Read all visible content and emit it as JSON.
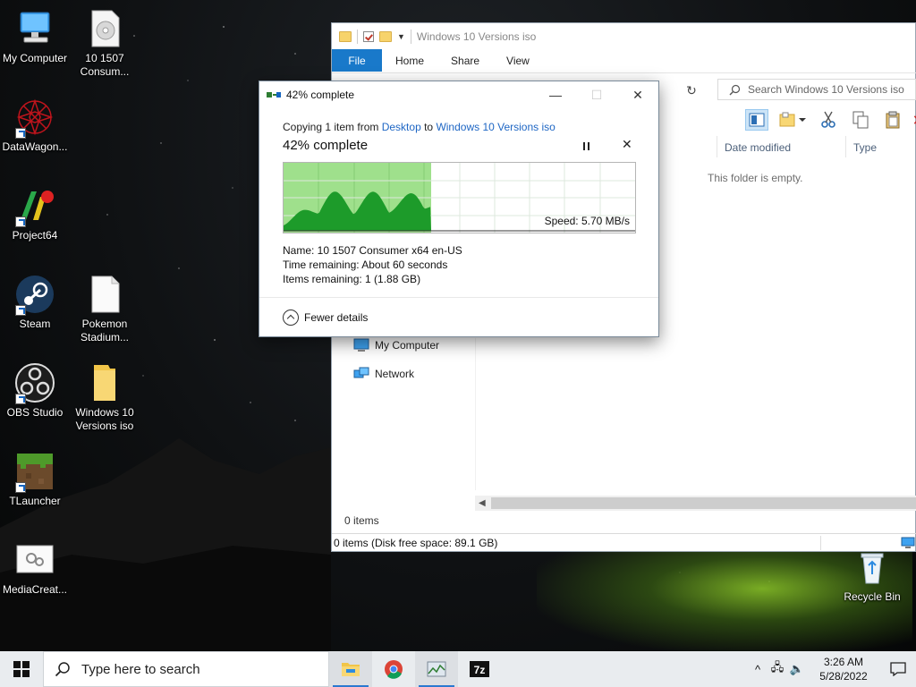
{
  "desktop": {
    "icons": [
      {
        "label": "My Computer",
        "icon": "computer-icon"
      },
      {
        "label": "10 1507 Consum...",
        "icon": "disc-image-icon"
      },
      {
        "label": "DataWagon...",
        "icon": "datawagon-icon"
      },
      {
        "label": "Project64",
        "icon": "project64-icon"
      },
      {
        "label": "Steam",
        "icon": "steam-icon"
      },
      {
        "label": "Pokemon Stadium...",
        "icon": "file-icon"
      },
      {
        "label": "OBS Studio",
        "icon": "obs-icon"
      },
      {
        "label": "Windows 10 Versions iso",
        "icon": "folder-icon"
      },
      {
        "label": "TLauncher",
        "icon": "tlauncher-icon"
      },
      {
        "label": "MediaCreat...",
        "icon": "media-creation-tool-icon"
      },
      {
        "label": "Recycle Bin",
        "icon": "recycle-bin-icon"
      }
    ]
  },
  "explorer": {
    "title": "Windows 10 Versions iso",
    "tabs": {
      "file": "File",
      "home": "Home",
      "share": "Share",
      "view": "View"
    },
    "search_placeholder": "Search Windows 10 Versions iso",
    "columns": {
      "date_modified": "Date modified",
      "type": "Type"
    },
    "empty_message": "This folder is empty.",
    "nav": {
      "my_computer": "My Computer",
      "network": "Network"
    },
    "items_count": "0 items",
    "status": "0 items (Disk free space: 89.1 GB)"
  },
  "copy_dialog": {
    "title": "42% complete",
    "copying_prefix": "Copying 1 item from ",
    "source": "Desktop",
    "to_word": " to ",
    "destination": "Windows 10 Versions iso",
    "percent_text": "42% complete",
    "progress_fraction": 0.42,
    "speed_text": "Speed: 5.70 MB/s",
    "name_text": "Name:  10 1507 Consumer x64 en-US",
    "time_remaining_text": "Time remaining:  About 60 seconds",
    "items_remaining_text": "Items remaining:  1 (1.88 GB)",
    "fewer_details": "Fewer details",
    "colors": {
      "graph_fill": "#9fe08c",
      "graph_line": "#1d9b2a",
      "link": "#1e66c4"
    }
  },
  "taskbar": {
    "search_placeholder": "Type here to search",
    "apps": [
      "file-explorer-icon",
      "chrome-icon",
      "task-manager-icon",
      "7zip-icon"
    ],
    "time": "3:26 AM",
    "date": "5/28/2022"
  }
}
